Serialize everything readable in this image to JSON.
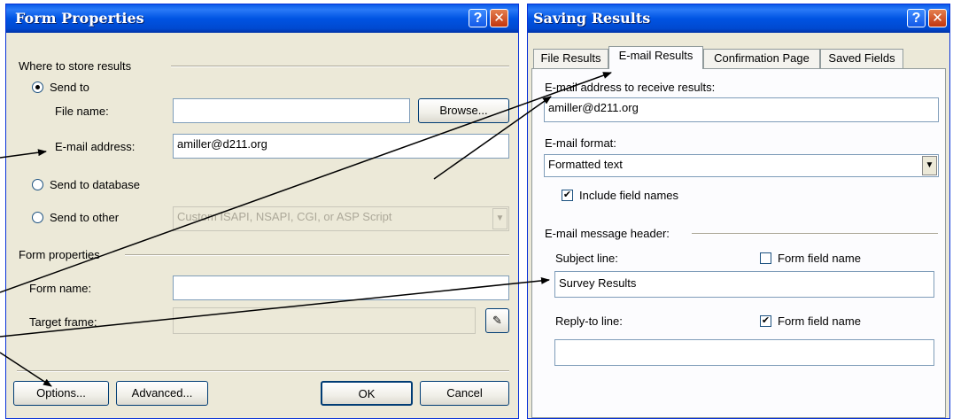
{
  "form_properties": {
    "title": "Form Properties",
    "help_glyph": "?",
    "close_glyph": "✕",
    "store_group_label": "Where to store results",
    "send_to_label": "Send to",
    "file_name_label": "File name:",
    "file_name_value": "",
    "browse_label": "Browse...",
    "email_address_label": "E-mail address:",
    "email_address_value": "amiller@d211.org",
    "send_to_database_label": "Send to database",
    "send_to_other_label": "Send to other",
    "send_to_other_option": "Custom ISAPI, NSAPI, CGI, or ASP Script",
    "form_props_group_label": "Form properties",
    "form_name_label": "Form name:",
    "form_name_value": "",
    "target_frame_label": "Target frame:",
    "target_frame_value": "",
    "options_label": "Options...",
    "advanced_label": "Advanced...",
    "ok_label": "OK",
    "cancel_label": "Cancel"
  },
  "saving_results": {
    "title": "Saving Results",
    "help_glyph": "?",
    "close_glyph": "✕",
    "tabs": [
      "File Results",
      "E-mail Results",
      "Confirmation Page",
      "Saved Fields"
    ],
    "active_tab": "E-mail Results",
    "email_receive_label": "E-mail address to receive results:",
    "email_receive_value": "amiller@d211.org",
    "email_format_label": "E-mail format:",
    "email_format_value": "Formatted text",
    "include_field_names_label": "Include field names",
    "include_field_names_checked": true,
    "message_header_group_label": "E-mail message header:",
    "subject_line_label": "Subject line:",
    "subject_form_field_label": "Form field name",
    "subject_form_field_checked": false,
    "subject_value": "Survey Results",
    "reply_to_label": "Reply-to line:",
    "reply_form_field_label": "Form field name",
    "reply_form_field_checked": true,
    "reply_to_value": ""
  },
  "icons": {
    "dropdown_arrow": "▼",
    "checkmark": "✔",
    "pencil": "✎"
  },
  "colors": {
    "title_bar": "#0054e3",
    "dialog_face": "#ece9d8",
    "annotation_arrow": "#000000"
  }
}
